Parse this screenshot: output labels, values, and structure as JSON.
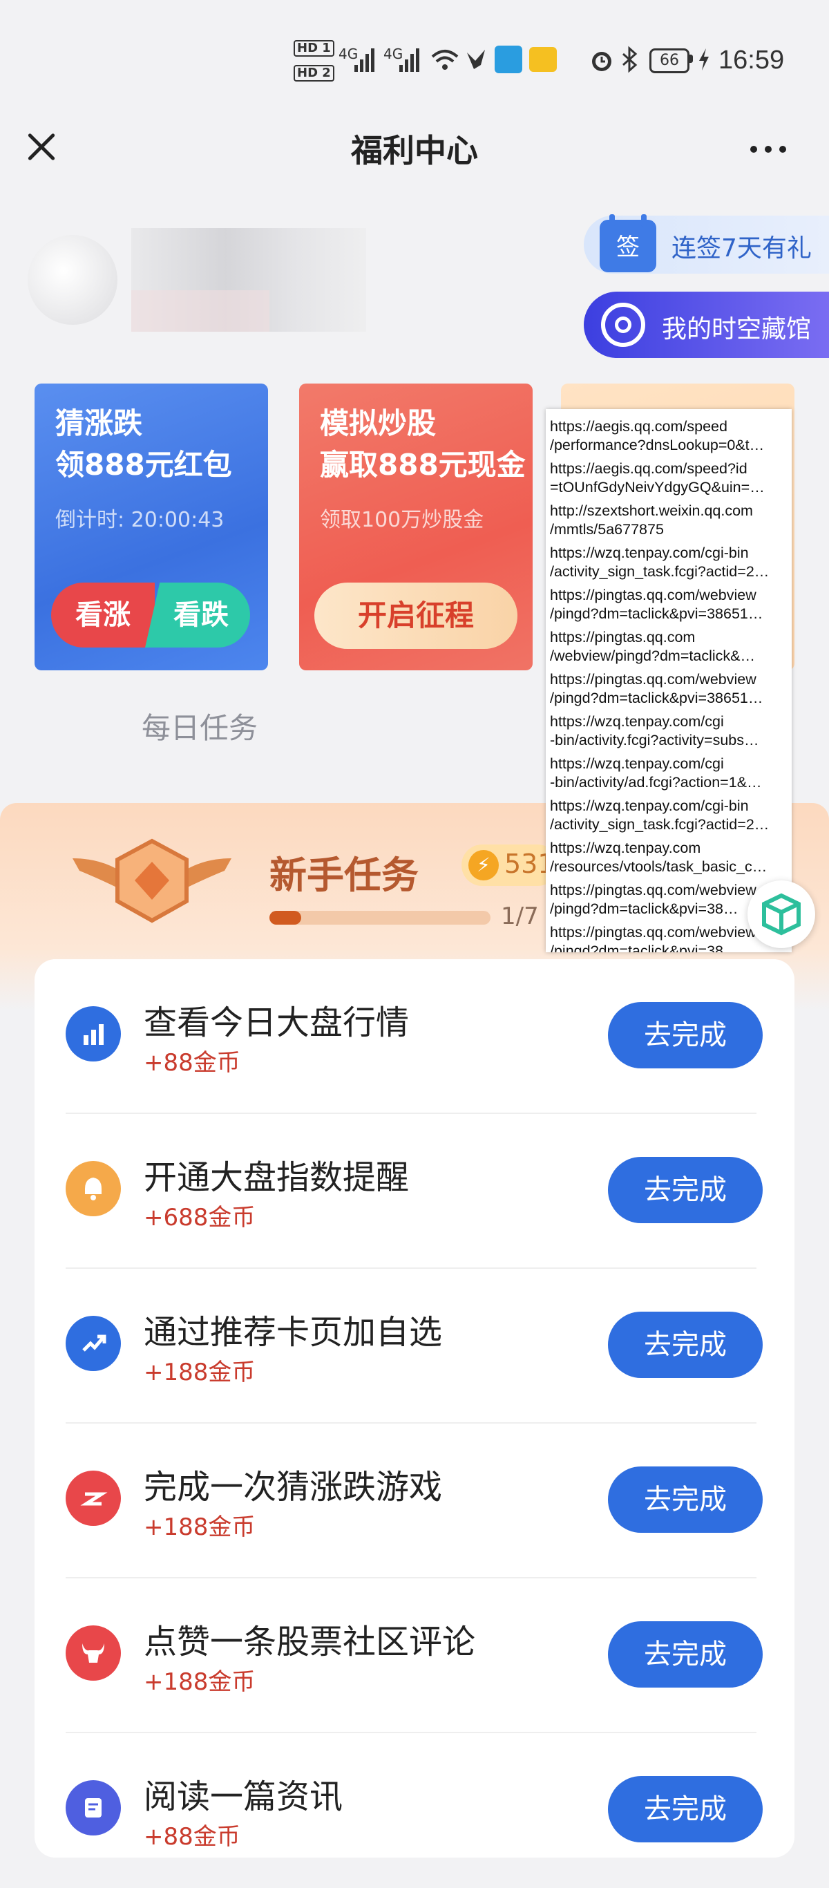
{
  "status_bar": {
    "hd1": "HD 1",
    "hd2": "HD 2",
    "net1": "4G",
    "net2": "4G",
    "battery": "66",
    "time": "16:59"
  },
  "header": {
    "title": "福利中心"
  },
  "side_pills": {
    "signin_icon": "签",
    "signin_label": "连签7天有礼",
    "treasure_label": "我的时空藏馆"
  },
  "promos": [
    {
      "title_line1": "猜涨跌",
      "title_line2": "领888元红包",
      "subtitle": "倒计时: 20:00:43",
      "btn_up": "看涨",
      "btn_down": "看跌"
    },
    {
      "title_line1": "模拟炒股",
      "title_line2": "赢取888元现金",
      "subtitle": "领取100万炒股金",
      "btn_start": "开启征程"
    }
  ],
  "daily_tasks_label": "每日任务",
  "newbie": {
    "title": "新手任务",
    "coin_value": "531",
    "progress_text": "1/7",
    "progress_fraction": 0.142857
  },
  "tasks": [
    {
      "name": "查看今日大盘行情",
      "reward": "+88金币",
      "button": "去完成",
      "icon": "bar-chart-icon",
      "color": "#2f6ee0"
    },
    {
      "name": "开通大盘指数提醒",
      "reward": "+688金币",
      "button": "去完成",
      "icon": "bell-icon",
      "color": "#f5a94a"
    },
    {
      "name": "通过推荐卡页加自选",
      "reward": "+188金币",
      "button": "去完成",
      "icon": "trend-up-icon",
      "color": "#2f6ee0"
    },
    {
      "name": "完成一次猜涨跌游戏",
      "reward": "+188金币",
      "button": "去完成",
      "icon": "updown-icon",
      "color": "#e8474a"
    },
    {
      "name": "点赞一条股票社区评论",
      "reward": "+188金币",
      "button": "去完成",
      "icon": "bull-icon",
      "color": "#e8474a"
    },
    {
      "name": "阅读一篇资讯",
      "reward": "+88金币",
      "button": "去完成",
      "icon": "article-icon",
      "color": "#4f5fe0"
    }
  ],
  "url_popup": [
    [
      "https://aegis.qq.com/speed",
      "/performance?dnsLookup=0&t…"
    ],
    [
      "https://aegis.qq.com/speed?id",
      "=tOUnfGdyNeivYdgyGQ&uin=…"
    ],
    [
      "http://szextshort.weixin.qq.com",
      "/mmtls/5a677875"
    ],
    [
      "https://wzq.tenpay.com/cgi-bin",
      "/activity_sign_task.fcgi?actid=2…"
    ],
    [
      "https://pingtas.qq.com/webview",
      "/pingd?dm=taclick&pvi=38651…"
    ],
    [
      "https://pingtas.qq.com",
      "/webview/pingd?dm=taclick&…"
    ],
    [
      "https://pingtas.qq.com/webview",
      "/pingd?dm=taclick&pvi=38651…"
    ],
    [
      "https://wzq.tenpay.com/cgi",
      "-bin/activity.fcgi?activity=subs…"
    ],
    [
      "https://wzq.tenpay.com/cgi",
      "-bin/activity/ad.fcgi?action=1&…"
    ],
    [
      "https://wzq.tenpay.com/cgi-bin",
      "/activity_sign_task.fcgi?actid=2…"
    ],
    [
      "https://wzq.tenpay.com",
      "/resources/vtools/task_basic_c…"
    ],
    [
      "https://pingtas.qq.com/webview",
      "/pingd?dm=taclick&pvi=38…"
    ],
    [
      "https://pingtas.qq.com/webview",
      "/pingd?dm=taclick&pvi=38…"
    ]
  ]
}
